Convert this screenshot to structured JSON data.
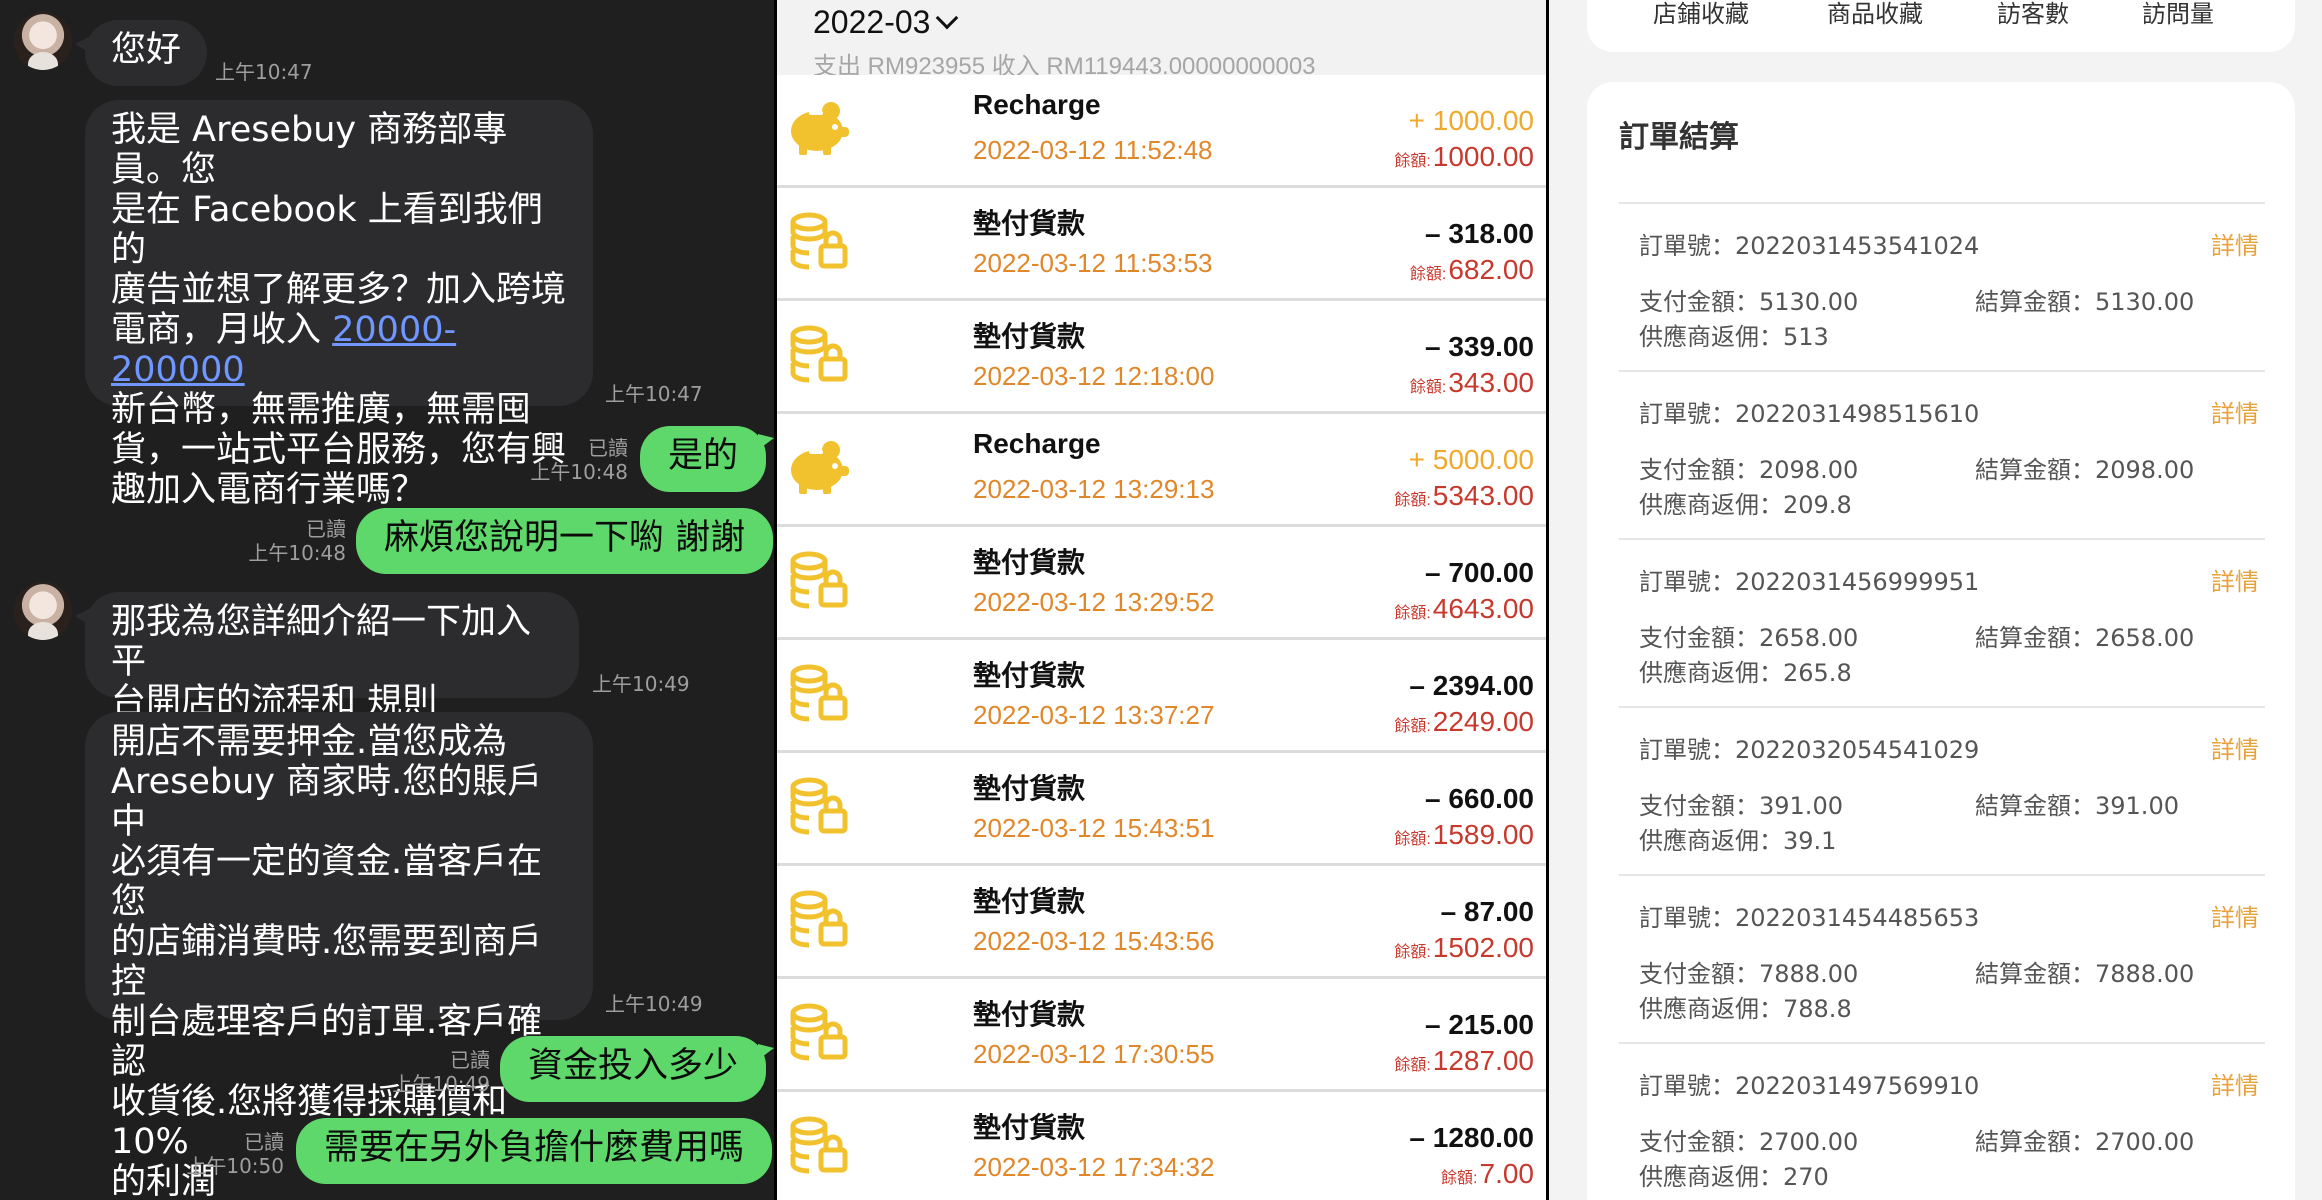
{
  "chat": {
    "messages": [
      {
        "side": "in",
        "text": "您好",
        "time": "上午10:47"
      },
      {
        "side": "in",
        "lines": [
          "我是 Aresebuy 商務部專員。您",
          "是在 Facebook 上看到我們的",
          "廣告並想了解更多？加入跨境"
        ],
        "line4_prefix": "電商，月收入 ",
        "link": "20000-200000",
        "lines_after": [
          "新台幣，無需推廣，無需囤",
          "貨，一站式平台服務，您有興",
          "趣加入電商行業嗎？"
        ],
        "time": "上午10:47"
      },
      {
        "side": "out",
        "text": "是的",
        "read": "已讀",
        "time": "上午10:48"
      },
      {
        "side": "out",
        "text": "麻煩您說明一下喲 謝謝",
        "read": "已讀",
        "time": "上午10:48"
      },
      {
        "side": "in",
        "lines": [
          "那我為您詳細介紹一下加入平",
          "台開店的流程和 規則"
        ],
        "time": "上午10:49"
      },
      {
        "side": "in",
        "lines": [
          "開店不需要押金.當您成為",
          "Aresebuy 商家時.您的賬戶中",
          "必須有一定的資金.當客戶在您",
          "的店鋪消費時.您需要到商戶控",
          "制台處理客戶的訂單.客戶確認",
          "收貨後.您將獲得採購價和 10%",
          "的利潤"
        ],
        "time": "上午10:49"
      },
      {
        "side": "out",
        "text": "資金投入多少",
        "read": "已讀",
        "time": "上午10:49"
      },
      {
        "side": "out",
        "text": "需要在另外負擔什麼費用嗎",
        "read": "已讀",
        "time": "上午10:50"
      }
    ]
  },
  "transactions": {
    "month": "2022-03",
    "summary": "支出 RM923955 收入 RM119443.00000000003",
    "balance_label": "餘額:",
    "colors": {
      "income": "#f0a92b",
      "date": "#e0872a",
      "balance": "#c8392d",
      "icon": "#f2c12e"
    },
    "rows": [
      {
        "icon": "piggy-bank-icon",
        "title": "Recharge",
        "date": "2022-03-12 11:52:48",
        "amount": "+ 1000.00",
        "type": "plus",
        "balance": "1000.00"
      },
      {
        "icon": "coins-lock-icon",
        "title": "墊付貨款",
        "date": "2022-03-12 11:53:53",
        "amount": "– 318.00",
        "type": "minus",
        "balance": "682.00"
      },
      {
        "icon": "coins-lock-icon",
        "title": "墊付貨款",
        "date": "2022-03-12 12:18:00",
        "amount": "– 339.00",
        "type": "minus",
        "balance": "343.00"
      },
      {
        "icon": "piggy-bank-icon",
        "title": "Recharge",
        "date": "2022-03-12 13:29:13",
        "amount": "+ 5000.00",
        "type": "plus",
        "balance": "5343.00"
      },
      {
        "icon": "coins-lock-icon",
        "title": "墊付貨款",
        "date": "2022-03-12 13:29:52",
        "amount": "– 700.00",
        "type": "minus",
        "balance": "4643.00"
      },
      {
        "icon": "coins-lock-icon",
        "title": "墊付貨款",
        "date": "2022-03-12 13:37:27",
        "amount": "– 2394.00",
        "type": "minus",
        "balance": "2249.00"
      },
      {
        "icon": "coins-lock-icon",
        "title": "墊付貨款",
        "date": "2022-03-12 15:43:51",
        "amount": "– 660.00",
        "type": "minus",
        "balance": "1589.00"
      },
      {
        "icon": "coins-lock-icon",
        "title": "墊付貨款",
        "date": "2022-03-12 15:43:56",
        "amount": "– 87.00",
        "type": "minus",
        "balance": "1502.00"
      },
      {
        "icon": "coins-lock-icon",
        "title": "墊付貨款",
        "date": "2022-03-12 17:30:55",
        "amount": "– 215.00",
        "type": "minus",
        "balance": "1287.00"
      },
      {
        "icon": "coins-lock-icon",
        "title": "墊付貨款",
        "date": "2022-03-12 17:34:32",
        "amount": "– 1280.00",
        "type": "minus",
        "balance": "7.00"
      }
    ]
  },
  "orders": {
    "stats": [
      "店鋪收藏",
      "商品收藏",
      "訪客數",
      "訪問量"
    ],
    "heading": "訂單結算",
    "order_no_label": "訂單號：",
    "detail_label": "詳情",
    "pay_label": "支付金額：",
    "settle_label": "結算金額：",
    "rebate_label": "供應商返佣：",
    "items": [
      {
        "no": "2022031453541024",
        "pay": "5130.00",
        "settle": "5130.00",
        "rebate": "513"
      },
      {
        "no": "2022031498515610",
        "pay": "2098.00",
        "settle": "2098.00",
        "rebate": "209.8"
      },
      {
        "no": "2022031456999951",
        "pay": "2658.00",
        "settle": "2658.00",
        "rebate": "265.8"
      },
      {
        "no": "2022032054541029",
        "pay": "391.00",
        "settle": "391.00",
        "rebate": "39.1"
      },
      {
        "no": "2022031454485653",
        "pay": "7888.00",
        "settle": "7888.00",
        "rebate": "788.8"
      },
      {
        "no": "2022031497569910",
        "pay": "2700.00",
        "settle": "2700.00",
        "rebate": "270"
      }
    ]
  }
}
